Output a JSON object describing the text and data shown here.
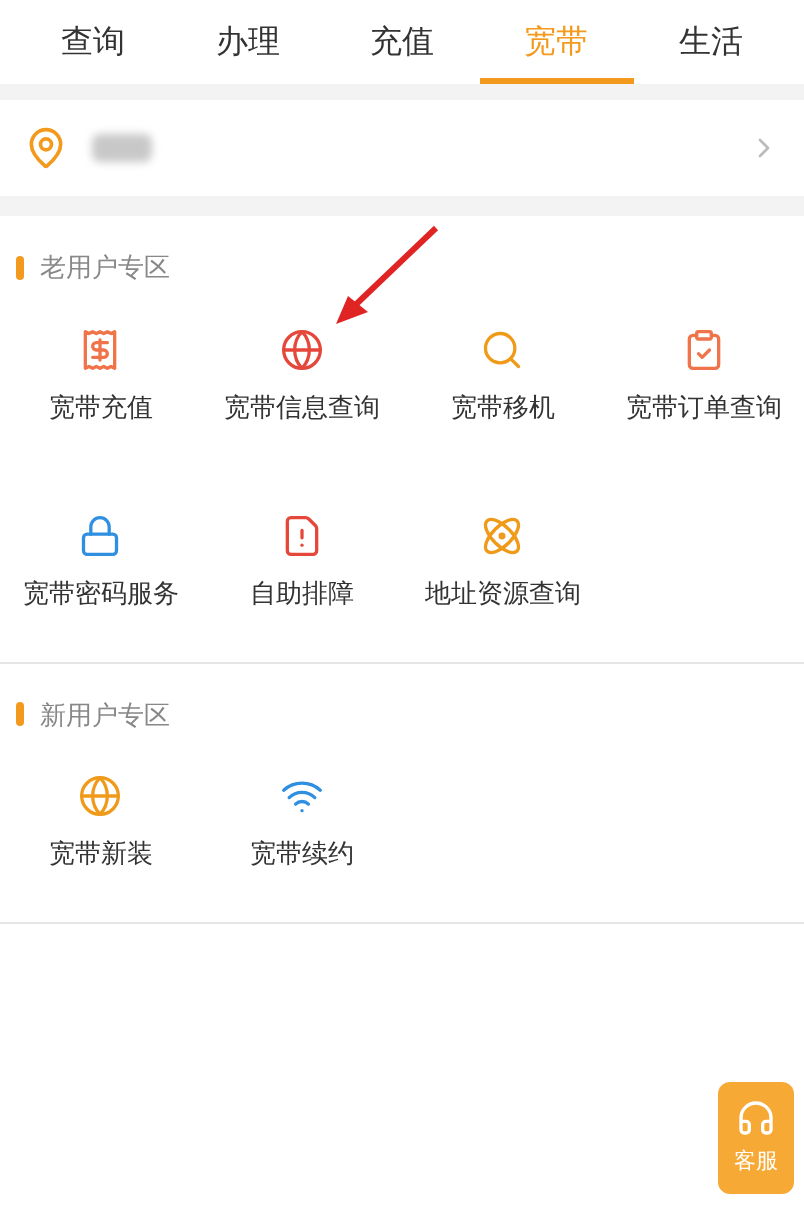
{
  "tabs": [
    {
      "label": "查询",
      "selected": false
    },
    {
      "label": "办理",
      "selected": false
    },
    {
      "label": "充值",
      "selected": false
    },
    {
      "label": "宽带",
      "selected": true
    },
    {
      "label": "生活",
      "selected": false
    }
  ],
  "location": {
    "kind": "redacted"
  },
  "sections": [
    {
      "title": "老用户专区",
      "items": [
        {
          "label": "宽带充值",
          "kind": "recharge"
        },
        {
          "label": "宽带信息查询",
          "kind": "info"
        },
        {
          "label": "宽带移机",
          "kind": "move"
        },
        {
          "label": "宽带订单查询",
          "kind": "order"
        },
        {
          "label": "宽带密码服务",
          "kind": "password"
        },
        {
          "label": "自助排障",
          "kind": "repair"
        },
        {
          "label": "地址资源查询",
          "kind": "address"
        }
      ]
    },
    {
      "title": "新用户专区",
      "items": [
        {
          "label": "宽带新装",
          "kind": "install"
        },
        {
          "label": "宽带续约",
          "kind": "renew"
        }
      ]
    }
  ],
  "service_button": {
    "label": "客服"
  }
}
